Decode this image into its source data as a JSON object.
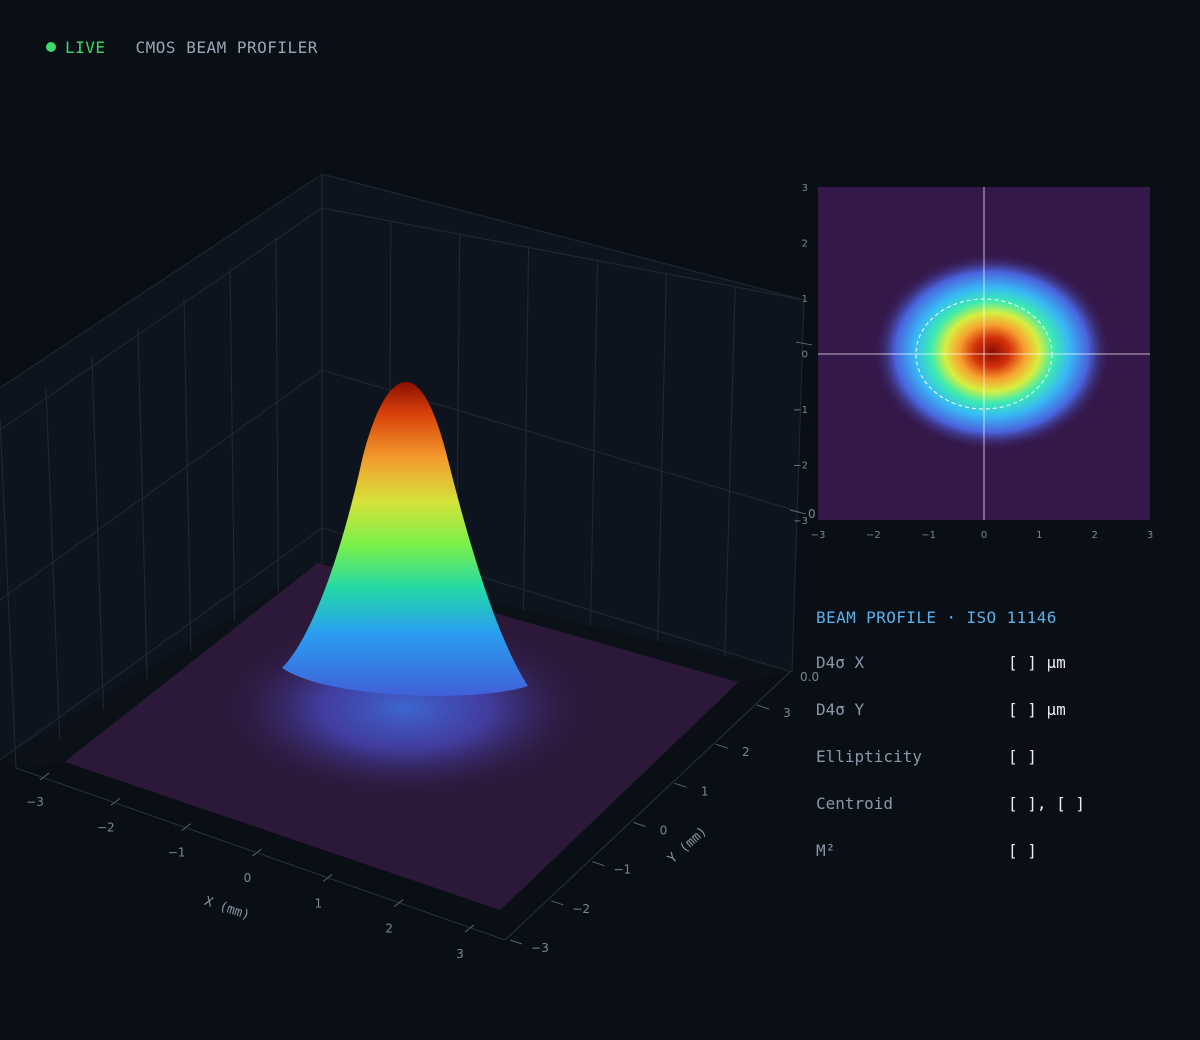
{
  "header": {
    "live_label": "LIVE",
    "app_title": "CMOS BEAM PROFILER"
  },
  "colors": {
    "background": "#0a0e15",
    "live": "#3ddc6a",
    "panel_title": "#58b2ee",
    "metric_label": "#8c97a8",
    "metric_value": "#e8edf3"
  },
  "chart_data": [
    {
      "type": "surface",
      "xlabel": "X (mm)",
      "ylabel": "Y (mm)",
      "xlim": [
        -3,
        3
      ],
      "ylim": [
        -3,
        3
      ],
      "zlim": [
        0,
        1
      ],
      "x_ticks": [
        "−3",
        "−2",
        "−1",
        "0",
        "1",
        "2",
        "3"
      ],
      "y_ticks": [
        "−3",
        "−2",
        "−1",
        "0",
        "1",
        "2",
        "3"
      ],
      "z_ticks": [
        "0.0",
        "0"
      ],
      "colormap": "turbo",
      "peak": 1.0,
      "center": [
        0,
        0
      ]
    },
    {
      "type": "heatmap",
      "xlim": [
        -3,
        3
      ],
      "ylim": [
        -3,
        3
      ],
      "x_ticks": [
        "−3",
        "−2",
        "−1",
        "0",
        "1",
        "2",
        "3"
      ],
      "y_ticks": [
        "3",
        "2",
        "1",
        "0",
        "−1",
        "−2",
        "−3"
      ],
      "centroid": [
        0,
        0
      ],
      "ellipse_radii": [
        1.2,
        1.0
      ],
      "colormap": "turbo"
    }
  ],
  "panel": {
    "title": "BEAM PROFILE · ISO 11146",
    "rows": [
      {
        "label": "D4σ X",
        "value": "[ ] µm"
      },
      {
        "label": "D4σ Y",
        "value": "[ ] µm"
      },
      {
        "label": "Ellipticity",
        "value": "[ ]"
      },
      {
        "label": "Centroid",
        "value": "[ ], [ ]"
      },
      {
        "label": "M²",
        "value": "[ ]"
      }
    ]
  }
}
